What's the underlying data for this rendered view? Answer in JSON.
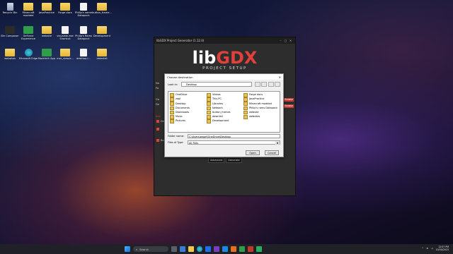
{
  "desktop": {
    "icons": [
      {
        "label": "Recycle Bin",
        "type": "bin"
      },
      {
        "label": "Minecraft modded",
        "type": "folder"
      },
      {
        "label": "JavaPractice",
        "type": "folder"
      },
      {
        "label": "Forge docs",
        "type": "folder"
      },
      {
        "label": "Philip's name Datapack",
        "type": "file"
      },
      {
        "label": "button_frame...",
        "type": "folder"
      },
      {
        "label": "Bin Composer",
        "type": "dark"
      },
      {
        "label": "GeForce Experience",
        "type": "green"
      },
      {
        "label": "website",
        "type": "folder"
      },
      {
        "label": "visualstn.exe Shortcut",
        "type": "file"
      },
      {
        "label": "Philip's Rams Datapack",
        "type": "file"
      },
      {
        "label": "Development",
        "type": "folder"
      },
      {
        "label": "websites",
        "type": "folder"
      },
      {
        "label": "Microsoft Edge",
        "type": "edge"
      },
      {
        "label": "Modrinth App",
        "type": "green"
      },
      {
        "label": "mar_view.b...",
        "type": "folder"
      },
      {
        "label": "desktop.i...",
        "type": "java"
      },
      {
        "label": "dalesfall",
        "type": "folder"
      }
    ]
  },
  "libgdx": {
    "title": "libGDX Project Generator (1.12.0)",
    "logo_a": "lib",
    "logo_b": "GDX",
    "subtitle": "PROJECT SETUP",
    "browse": "Browse",
    "advanced": "Advanced",
    "generate": "Generate",
    "side_labels": [
      "Na",
      "Pa",
      "Ga",
      "De",
      "Bo",
      "Sub",
      "Des",
      "Em"
    ]
  },
  "dialog": {
    "title": "Choose destination",
    "look_in_label": "Look In:",
    "look_in_value": "Desktop",
    "files": [
      {
        "name": "OneDrive",
        "icon": "folder"
      },
      {
        "name": "Videos",
        "icon": "folder"
      },
      {
        "name": "Forge docs",
        "icon": "folder"
      },
      {
        "name": "zapl",
        "icon": "folder"
      },
      {
        "name": "This PC",
        "icon": "folder"
      },
      {
        "name": "JavaPractice",
        "icon": "folder"
      },
      {
        "name": "Desktop",
        "icon": "folder"
      },
      {
        "name": "Libraries",
        "icon": "folder"
      },
      {
        "name": "Minecraft modded",
        "icon": "folder"
      },
      {
        "name": "Documents",
        "icon": "folder"
      },
      {
        "name": "Network",
        "icon": "folder"
      },
      {
        "name": "Philip's rams Datapack",
        "icon": "folder"
      },
      {
        "name": "Downloads",
        "icon": "folder"
      },
      {
        "name": "button_frames",
        "icon": "folder"
      },
      {
        "name": "website",
        "icon": "folder"
      },
      {
        "name": "Music",
        "icon": "folder"
      },
      {
        "name": "dawnfall",
        "icon": "folder"
      },
      {
        "name": "websites",
        "icon": "folder"
      },
      {
        "name": "Pictures",
        "icon": "folder"
      },
      {
        "name": "Development",
        "icon": "folder"
      }
    ],
    "folder_name_label": "Folder name:",
    "folder_name_value": "C:\\Users\\angel\\OneDrive\\Desktop",
    "files_of_type_label": "Files of Type:",
    "files_of_type_value": "All Files",
    "open": "Open",
    "cancel": "Cancel"
  },
  "taskbar": {
    "search_placeholder": "Search",
    "time": "12:07 PM",
    "date": "10/30/2023"
  }
}
